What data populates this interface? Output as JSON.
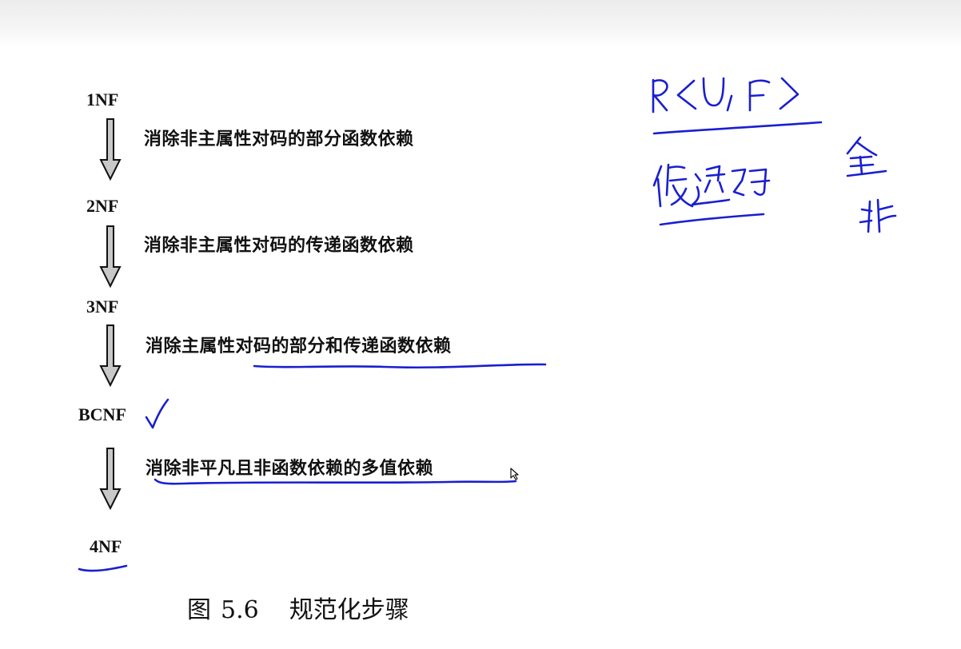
{
  "diagram": {
    "levels": [
      "1NF",
      "2NF",
      "3NF",
      "BCNF",
      "4NF"
    ],
    "steps": [
      "消除非主属性对码的部分函数依赖",
      "消除非主属性对码的传递函数依赖",
      "消除主属性对码的部分和传递函数依赖",
      "消除非平凡且非函数依赖的多值依赖"
    ],
    "caption": {
      "figure": "图",
      "number": "5.6",
      "title": "规范化步骤"
    }
  },
  "colors": {
    "ink": "#1a1fcf",
    "text": "#111111",
    "arrow_fill": "#c8c8c8",
    "toolbar": "#ececec"
  }
}
